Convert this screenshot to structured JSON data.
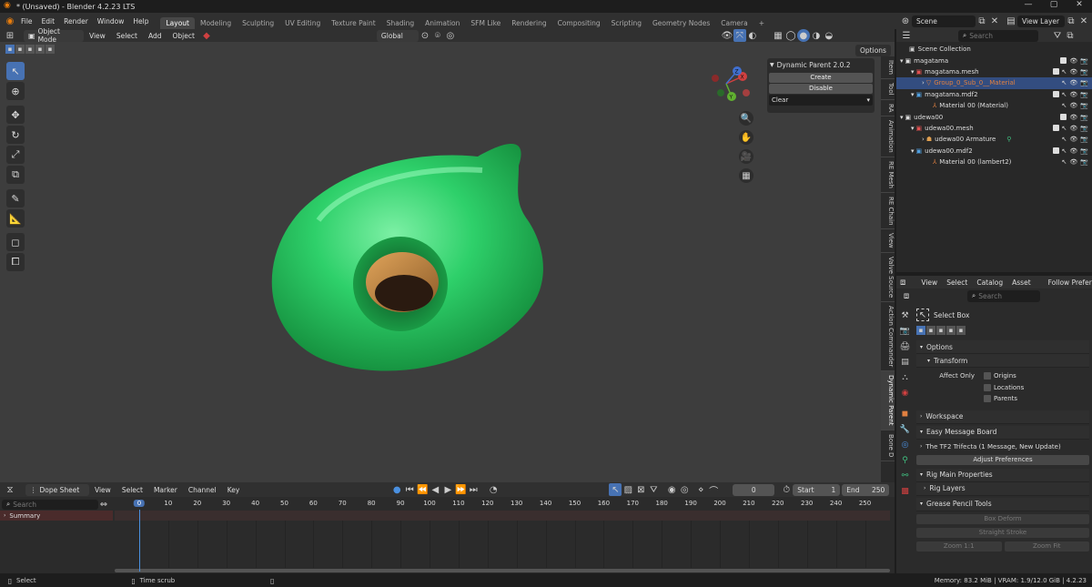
{
  "window": {
    "title": "* (Unsaved) - Blender 4.2.23 LTS"
  },
  "menu": [
    "File",
    "Edit",
    "Render",
    "Window",
    "Help"
  ],
  "workspaces": [
    "Layout",
    "Modeling",
    "Sculpting",
    "UV Editing",
    "Texture Paint",
    "Shading",
    "Animation",
    "SFM Like",
    "Rendering",
    "Compositing",
    "Scripting",
    "Geometry Nodes",
    "Camera"
  ],
  "active_workspace": "Layout",
  "scene": {
    "label": "Scene",
    "view_layer": "View Layer"
  },
  "viewport": {
    "mode": "Object Mode",
    "menus": [
      "View",
      "Select",
      "Add",
      "Object"
    ],
    "orientation": "Global",
    "options": "Options"
  },
  "npanel": {
    "title": "Dynamic Parent 2.0.2",
    "create": "Create",
    "disable": "Disable",
    "clear": "Clear",
    "tabs": [
      "Item",
      "Tool",
      "RA",
      "Animation",
      "RE Mesh",
      "RE Chain",
      "View",
      "Valve Source",
      "Action Commander",
      "Dynamic Parent",
      "Bone D"
    ]
  },
  "outliner": {
    "search_placeholder": "Search",
    "rows": [
      {
        "label": "Scene Collection"
      },
      {
        "label": "magatama"
      },
      {
        "label": "magatama.mesh"
      },
      {
        "label": "Group_0_Sub_0__Material"
      },
      {
        "label": "magatama.mdf2"
      },
      {
        "label": "Material 00 (Material)"
      },
      {
        "label": "udewa00"
      },
      {
        "label": "udewa00.mesh"
      },
      {
        "label": "udewa00 Armature"
      },
      {
        "label": "udewa00.mdf2"
      },
      {
        "label": "Material 00 (lambert2)"
      }
    ]
  },
  "asset": {
    "menus": [
      "View",
      "Select",
      "Catalog",
      "Asset"
    ],
    "follow": "Follow Prefere",
    "search_placeholder": "Search"
  },
  "properties": {
    "tool": "Select Box",
    "options": "Options",
    "transform": "Transform",
    "affect_only": "Affect Only",
    "origins": "Origins",
    "locations": "Locations",
    "parents": "Parents",
    "workspace": "Workspace",
    "easy_message": "Easy Message Board",
    "trifecta": "The TF2 Trifecta (1 Message, New Update)",
    "adjust": "Adjust Preferences",
    "rig_main": "Rig Main Properties",
    "rig_layers": "Rig Layers",
    "grease": "Grease Pencil Tools",
    "box_deform": "Box Deform",
    "straight": "Straight Stroke",
    "zoom11": "Zoom 1:1",
    "zoomfit": "Zoom Fit"
  },
  "dopesheet": {
    "editor": "Dope Sheet",
    "menus": [
      "View",
      "Select",
      "Marker",
      "Channel",
      "Key"
    ],
    "search_placeholder": "Search",
    "summary": "Summary",
    "current_frame": "0",
    "start_label": "Start",
    "start": "1",
    "end_label": "End",
    "end": "250",
    "ticks": [
      "0",
      "10",
      "20",
      "30",
      "40",
      "50",
      "60",
      "70",
      "80",
      "90",
      "100",
      "110",
      "120",
      "130",
      "140",
      "150",
      "160",
      "170",
      "180",
      "190",
      "200",
      "210",
      "220",
      "230",
      "240",
      "250"
    ]
  },
  "status": {
    "select": "Select",
    "timescrub": "Time scrub",
    "memory": "Memory: 83.2 MiB | VRAM: 1.9/12.0 GiB | 4.2.23"
  },
  "gizmo": {
    "x": "X",
    "y": "Y",
    "z": "Z"
  }
}
